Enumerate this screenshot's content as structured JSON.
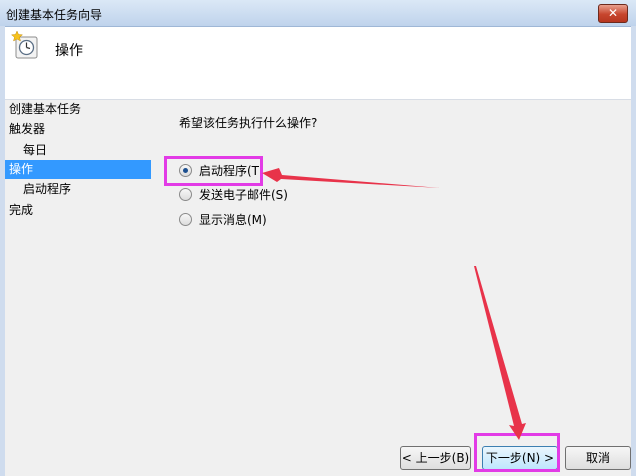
{
  "window": {
    "title": "创建基本任务向导",
    "close_symbol": "✕"
  },
  "header": {
    "title": "操作",
    "icon": "task-clock-icon"
  },
  "sidebar": {
    "items": [
      {
        "label": "创建基本任务"
      },
      {
        "label": "触发器"
      },
      {
        "label": "每日"
      },
      {
        "label": "操作"
      },
      {
        "label": "启动程序"
      },
      {
        "label": "完成"
      }
    ]
  },
  "content": {
    "question": "希望该任务执行什么操作?",
    "options": [
      {
        "label": "启动程序(T)",
        "selected": true
      },
      {
        "label": "发送电子邮件(S)",
        "selected": false
      },
      {
        "label": "显示消息(M)",
        "selected": false
      }
    ]
  },
  "buttons": {
    "back": "< 上一步(B)",
    "next": "下一步(N) >",
    "cancel": "取消"
  },
  "colors": {
    "selection": "#3399ff",
    "highlight": "#e23be6",
    "arrow": "#e8334a"
  }
}
